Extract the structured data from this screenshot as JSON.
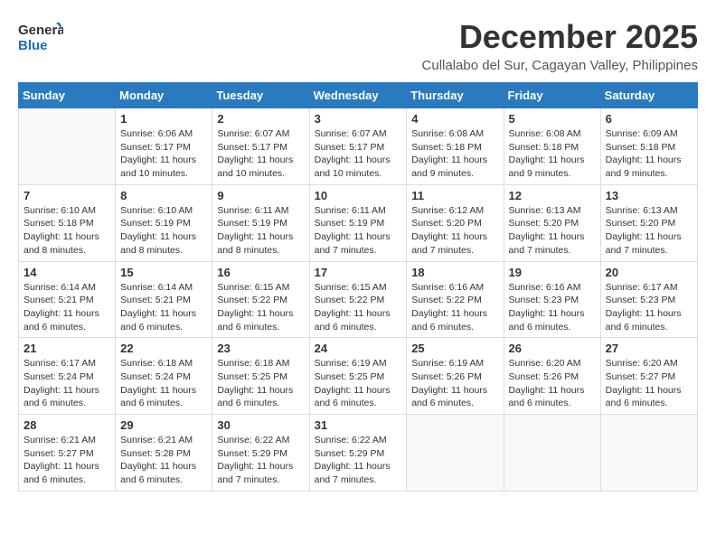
{
  "logo": {
    "line1": "General",
    "line2": "Blue"
  },
  "title": "December 2025",
  "subtitle": "Cullalabo del Sur, Cagayan Valley, Philippines",
  "weekdays": [
    "Sunday",
    "Monday",
    "Tuesday",
    "Wednesday",
    "Thursday",
    "Friday",
    "Saturday"
  ],
  "weeks": [
    [
      {
        "day": "",
        "info": ""
      },
      {
        "day": "1",
        "info": "Sunrise: 6:06 AM\nSunset: 5:17 PM\nDaylight: 11 hours and 10 minutes."
      },
      {
        "day": "2",
        "info": "Sunrise: 6:07 AM\nSunset: 5:17 PM\nDaylight: 11 hours and 10 minutes."
      },
      {
        "day": "3",
        "info": "Sunrise: 6:07 AM\nSunset: 5:17 PM\nDaylight: 11 hours and 10 minutes."
      },
      {
        "day": "4",
        "info": "Sunrise: 6:08 AM\nSunset: 5:18 PM\nDaylight: 11 hours and 9 minutes."
      },
      {
        "day": "5",
        "info": "Sunrise: 6:08 AM\nSunset: 5:18 PM\nDaylight: 11 hours and 9 minutes."
      },
      {
        "day": "6",
        "info": "Sunrise: 6:09 AM\nSunset: 5:18 PM\nDaylight: 11 hours and 9 minutes."
      }
    ],
    [
      {
        "day": "7",
        "info": "Sunrise: 6:10 AM\nSunset: 5:18 PM\nDaylight: 11 hours and 8 minutes."
      },
      {
        "day": "8",
        "info": "Sunrise: 6:10 AM\nSunset: 5:19 PM\nDaylight: 11 hours and 8 minutes."
      },
      {
        "day": "9",
        "info": "Sunrise: 6:11 AM\nSunset: 5:19 PM\nDaylight: 11 hours and 8 minutes."
      },
      {
        "day": "10",
        "info": "Sunrise: 6:11 AM\nSunset: 5:19 PM\nDaylight: 11 hours and 7 minutes."
      },
      {
        "day": "11",
        "info": "Sunrise: 6:12 AM\nSunset: 5:20 PM\nDaylight: 11 hours and 7 minutes."
      },
      {
        "day": "12",
        "info": "Sunrise: 6:13 AM\nSunset: 5:20 PM\nDaylight: 11 hours and 7 minutes."
      },
      {
        "day": "13",
        "info": "Sunrise: 6:13 AM\nSunset: 5:20 PM\nDaylight: 11 hours and 7 minutes."
      }
    ],
    [
      {
        "day": "14",
        "info": "Sunrise: 6:14 AM\nSunset: 5:21 PM\nDaylight: 11 hours and 6 minutes."
      },
      {
        "day": "15",
        "info": "Sunrise: 6:14 AM\nSunset: 5:21 PM\nDaylight: 11 hours and 6 minutes."
      },
      {
        "day": "16",
        "info": "Sunrise: 6:15 AM\nSunset: 5:22 PM\nDaylight: 11 hours and 6 minutes."
      },
      {
        "day": "17",
        "info": "Sunrise: 6:15 AM\nSunset: 5:22 PM\nDaylight: 11 hours and 6 minutes."
      },
      {
        "day": "18",
        "info": "Sunrise: 6:16 AM\nSunset: 5:22 PM\nDaylight: 11 hours and 6 minutes."
      },
      {
        "day": "19",
        "info": "Sunrise: 6:16 AM\nSunset: 5:23 PM\nDaylight: 11 hours and 6 minutes."
      },
      {
        "day": "20",
        "info": "Sunrise: 6:17 AM\nSunset: 5:23 PM\nDaylight: 11 hours and 6 minutes."
      }
    ],
    [
      {
        "day": "21",
        "info": "Sunrise: 6:17 AM\nSunset: 5:24 PM\nDaylight: 11 hours and 6 minutes."
      },
      {
        "day": "22",
        "info": "Sunrise: 6:18 AM\nSunset: 5:24 PM\nDaylight: 11 hours and 6 minutes."
      },
      {
        "day": "23",
        "info": "Sunrise: 6:18 AM\nSunset: 5:25 PM\nDaylight: 11 hours and 6 minutes."
      },
      {
        "day": "24",
        "info": "Sunrise: 6:19 AM\nSunset: 5:25 PM\nDaylight: 11 hours and 6 minutes."
      },
      {
        "day": "25",
        "info": "Sunrise: 6:19 AM\nSunset: 5:26 PM\nDaylight: 11 hours and 6 minutes."
      },
      {
        "day": "26",
        "info": "Sunrise: 6:20 AM\nSunset: 5:26 PM\nDaylight: 11 hours and 6 minutes."
      },
      {
        "day": "27",
        "info": "Sunrise: 6:20 AM\nSunset: 5:27 PM\nDaylight: 11 hours and 6 minutes."
      }
    ],
    [
      {
        "day": "28",
        "info": "Sunrise: 6:21 AM\nSunset: 5:27 PM\nDaylight: 11 hours and 6 minutes."
      },
      {
        "day": "29",
        "info": "Sunrise: 6:21 AM\nSunset: 5:28 PM\nDaylight: 11 hours and 6 minutes."
      },
      {
        "day": "30",
        "info": "Sunrise: 6:22 AM\nSunset: 5:29 PM\nDaylight: 11 hours and 7 minutes."
      },
      {
        "day": "31",
        "info": "Sunrise: 6:22 AM\nSunset: 5:29 PM\nDaylight: 11 hours and 7 minutes."
      },
      {
        "day": "",
        "info": ""
      },
      {
        "day": "",
        "info": ""
      },
      {
        "day": "",
        "info": ""
      }
    ]
  ]
}
